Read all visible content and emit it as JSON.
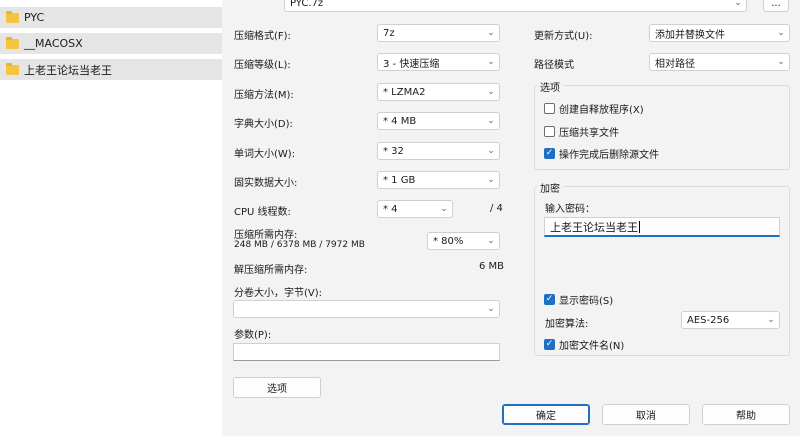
{
  "explorer": {
    "folders": [
      {
        "name": "PYC"
      },
      {
        "name": "__MACOSX"
      },
      {
        "name": "上老王论坛当老王"
      }
    ]
  },
  "archive": {
    "path": "PYC.7z",
    "browse_label": "..."
  },
  "form": {
    "format": {
      "label": "压缩格式(F):",
      "value": "7z"
    },
    "level": {
      "label": "压缩等级(L):",
      "value": "3 - 快速压缩"
    },
    "method": {
      "label": "压缩方法(M):",
      "value": "* LZMA2"
    },
    "dict": {
      "label": "字典大小(D):",
      "value": "* 4 MB"
    },
    "word": {
      "label": "单词大小(W):",
      "value": "* 32"
    },
    "solid": {
      "label": "固实数据大小:",
      "value": "* 1 GB"
    },
    "threads": {
      "label": "CPU 线程数:",
      "value": "* 4",
      "max": "/ 4"
    },
    "mem_compress": {
      "label": "压缩所需内存:",
      "detail": "248 MB / 6378 MB / 7972 MB",
      "value": "* 80%"
    },
    "mem_decompress": {
      "label": "解压缩所需内存:",
      "value": "6 MB"
    },
    "volume": {
      "label": "分卷大小，字节(V):",
      "value": ""
    },
    "params": {
      "label": "参数(P):",
      "value": ""
    },
    "options_button": "选项"
  },
  "update": {
    "label": "更新方式(U):",
    "value": "添加并替换文件"
  },
  "pathmode": {
    "label": "路径模式",
    "value": "相对路径"
  },
  "options": {
    "title": "选项",
    "sfx": {
      "label": "创建自释放程序(X)",
      "checked": false
    },
    "shared": {
      "label": "压缩共享文件",
      "checked": false
    },
    "delete_after": {
      "label": "操作完成后删除源文件",
      "checked": true
    }
  },
  "encryption": {
    "title": "加密",
    "password_label": "输入密码：",
    "password_value": "上老王论坛当老王",
    "show_password": {
      "label": "显示密码(S)",
      "checked": true
    },
    "method_label": "加密算法:",
    "method_value": "AES-256",
    "encrypt_names": {
      "label": "加密文件名(N)",
      "checked": true
    }
  },
  "buttons": {
    "ok": "确定",
    "cancel": "取消",
    "help": "帮助"
  }
}
